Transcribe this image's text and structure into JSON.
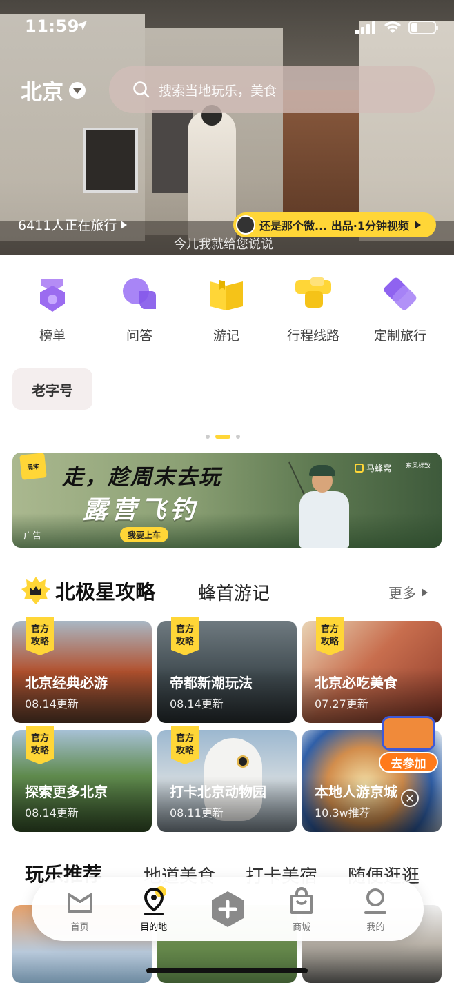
{
  "status": {
    "time": "11:59"
  },
  "header": {
    "city": "北京",
    "search_placeholder": "搜索当地玩乐，美食"
  },
  "hero": {
    "travelers": "6411人正在旅行",
    "video_label": "还是那个微... 出品·1分钟视频",
    "subtitle": "今儿我就给您说说"
  },
  "categories": [
    {
      "label": "榜单",
      "icon": "ranking-icon"
    },
    {
      "label": "问答",
      "icon": "qa-icon"
    },
    {
      "label": "游记",
      "icon": "travelogue-icon"
    },
    {
      "label": "行程线路",
      "icon": "route-icon"
    },
    {
      "label": "定制旅行",
      "icon": "custom-travel-icon"
    }
  ],
  "tag_button": "老字号",
  "ad": {
    "line1": "走，趁周末去玩",
    "line2": "露营飞钓",
    "cta": "我要上车",
    "ad_label": "广告",
    "brand": "马蜂窝",
    "badge": "周末",
    "brand2": "东风标致"
  },
  "guide_section": {
    "active_tab": "北极星攻略",
    "other_tab": "蜂首游记",
    "more": "更多",
    "official_badge": "官方攻略",
    "cards": [
      {
        "title": "北京经典必游",
        "sub": "08.14更新",
        "official": true
      },
      {
        "title": "帝都新潮玩法",
        "sub": "08.14更新",
        "official": true
      },
      {
        "title": "北京必吃美食",
        "sub": "07.27更新",
        "official": true
      },
      {
        "title": "探索更多北京",
        "sub": "08.14更新",
        "official": true
      },
      {
        "title": "打卡北京动物园",
        "sub": "08.11更新",
        "official": true
      },
      {
        "title": "本地人游京城",
        "sub": "10.3w推荐",
        "official": false
      }
    ],
    "join_label": "去参加"
  },
  "play_section": {
    "tabs": [
      "玩乐推荐",
      "地道美食",
      "打卡美宿",
      "随便逛逛"
    ]
  },
  "bottom_nav": [
    {
      "label": "首页",
      "icon": "home-icon"
    },
    {
      "label": "目的地",
      "icon": "destination-icon",
      "active": true
    },
    {
      "label": "",
      "icon": "plus-icon"
    },
    {
      "label": "商城",
      "icon": "shop-icon"
    },
    {
      "label": "我的",
      "icon": "profile-icon"
    }
  ],
  "colors": {
    "accent": "#ffd637",
    "purple": "#9b6cf0",
    "orange": "#ff7a1a"
  }
}
